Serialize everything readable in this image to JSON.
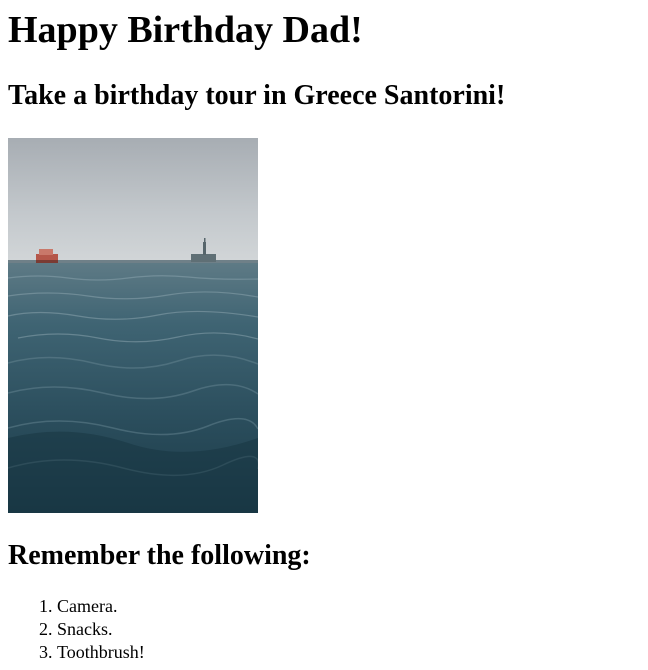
{
  "heading": "Happy Birthday Dad!",
  "subheading": "Take a birthday tour in Greece Santorini!",
  "image": {
    "alt": "Sea view with a ferry boat and the Statue of Liberty on the horizon"
  },
  "list_heading": "Remember the following:",
  "list_items": [
    "Camera.",
    "Snacks.",
    "Toothbrush!"
  ]
}
